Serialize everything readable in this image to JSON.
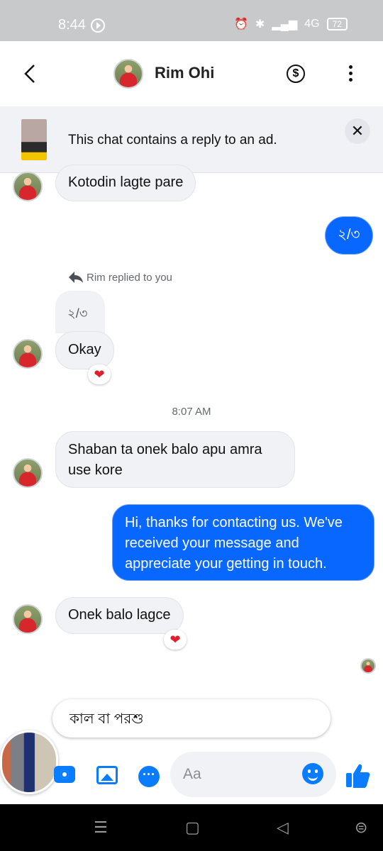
{
  "status_bar": {
    "time": "8:44",
    "battery": "72",
    "network": "4G"
  },
  "header": {
    "contact_name": "Rim Ohi",
    "back_icon": "chevron-left-icon",
    "payment_icon": "dollar-circle-icon",
    "menu_icon": "kebab-menu-icon"
  },
  "ad_banner": {
    "text": "This chat contains a reply to an ad."
  },
  "messages": {
    "m1": "Kotodin lagte pare",
    "m2": "২/৩",
    "reply_label": "Rim replied to you",
    "quoted": "২/৩",
    "m3": "Okay",
    "reaction": "❤",
    "timestamp": "8:07 AM",
    "m4": "Shaban ta onek  balo apu amra use kore",
    "m5": "Hi, thanks for contacting us. We've received your message and appreciate your getting in touch.",
    "m6": "Onek balo lagce"
  },
  "composer": {
    "suggestion": "কাল বা পরশু",
    "placeholder": "Aa"
  },
  "colors": {
    "accent": "#0867ff",
    "incoming_bubble": "#f0f2f5",
    "reaction": "#e11d2e"
  }
}
